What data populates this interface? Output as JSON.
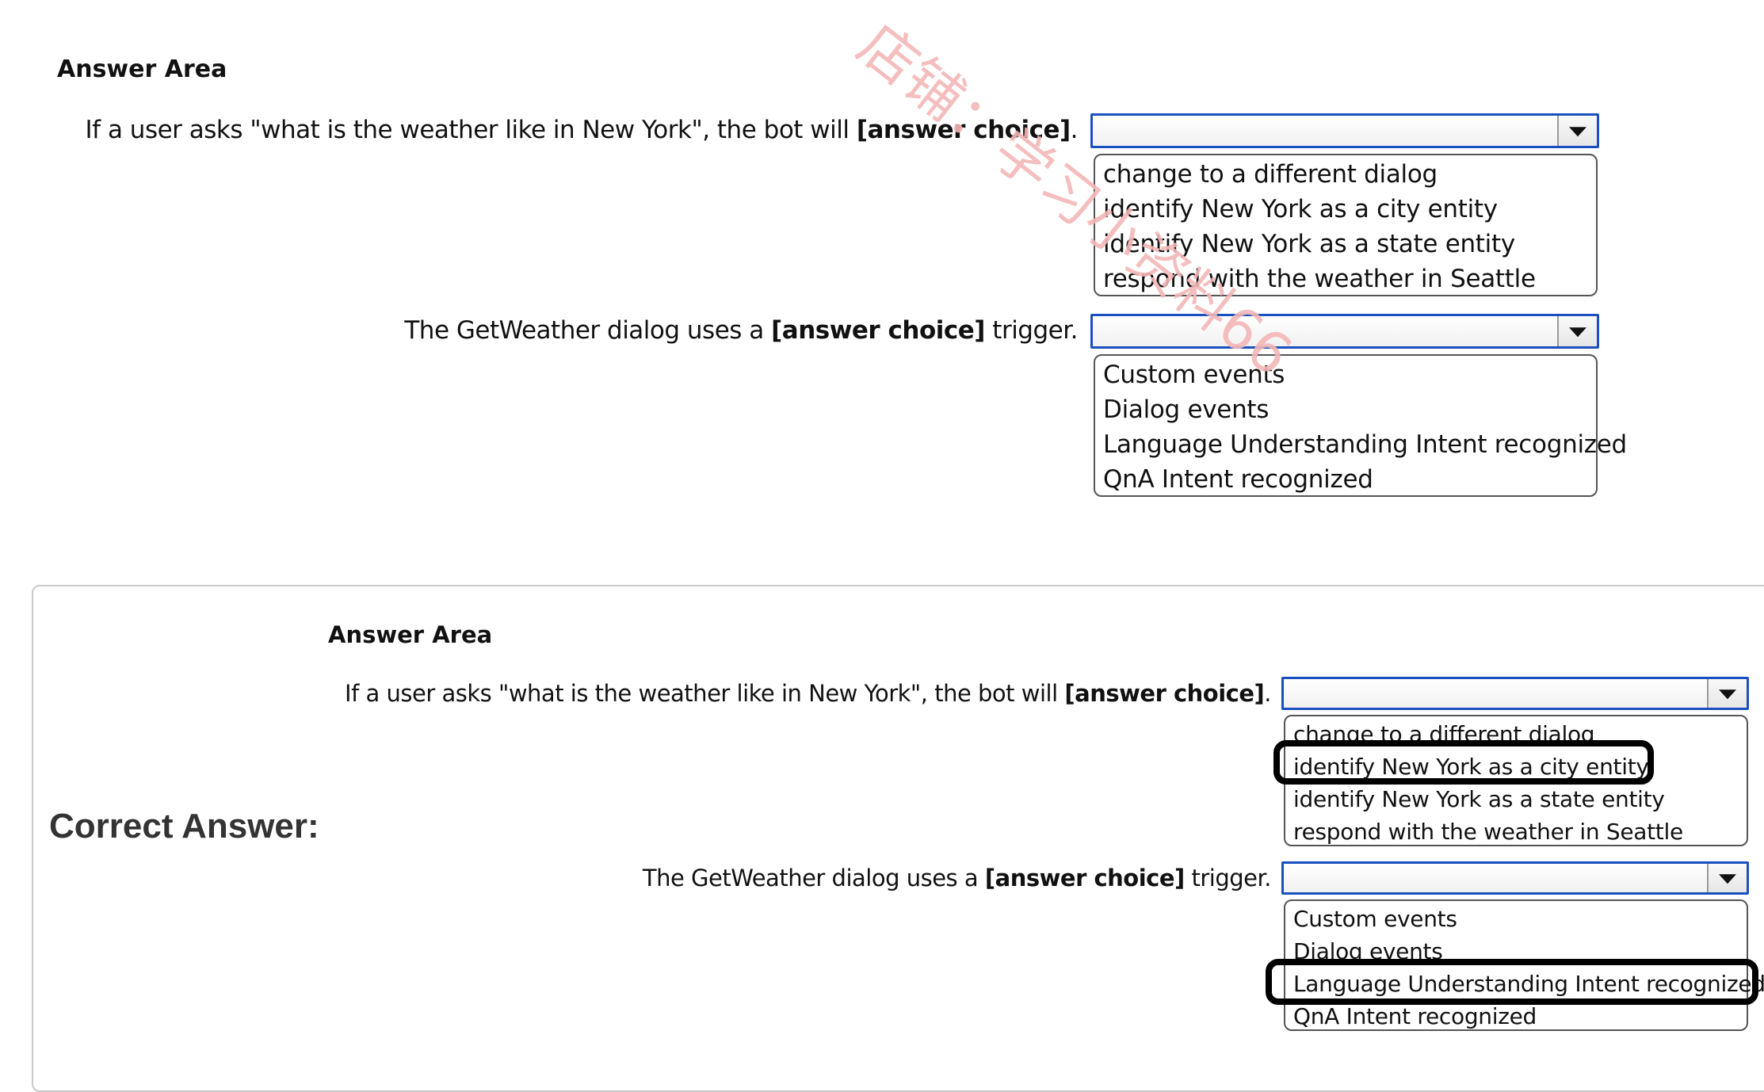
{
  "watermark": "店铺：学习小资料66",
  "top": {
    "heading": "Answer Area",
    "q1": {
      "prefix": "If a user asks \"what is the weather like in New York\", the bot will ",
      "bold": "[answer choice]",
      "suffix": "."
    },
    "q1_options": [
      "change to a different dialog",
      "identify New York as a city entity",
      "identify New York as a state entity",
      "respond with the weather in Seattle"
    ],
    "q2": {
      "prefix": "The GetWeather dialog uses a ",
      "bold": "[answer choice]",
      "suffix": " trigger."
    },
    "q2_options": [
      "Custom events",
      "Dialog events",
      "Language Understanding Intent recognized",
      "QnA Intent recognized"
    ]
  },
  "bottom": {
    "correct_label": "Correct Answer:",
    "heading": "Answer Area",
    "q1": {
      "prefix": "If a user asks \"what is the weather like in New York\", the bot will ",
      "bold": "[answer choice]",
      "suffix": "."
    },
    "q1_options": [
      "change to a different dialog",
      "identify New York as a city entity",
      "identify New York as a state entity",
      "respond with the weather in Seattle"
    ],
    "q1_selected": "identify New York as a city entity",
    "q2": {
      "prefix": "The GetWeather dialog uses a ",
      "bold": "[answer choice]",
      "suffix": " trigger."
    },
    "q2_options": [
      "Custom events",
      "Dialog events",
      "Language Understanding Intent recognized",
      "QnA Intent recognized"
    ],
    "q2_selected": "Language Understanding Intent recognized"
  }
}
